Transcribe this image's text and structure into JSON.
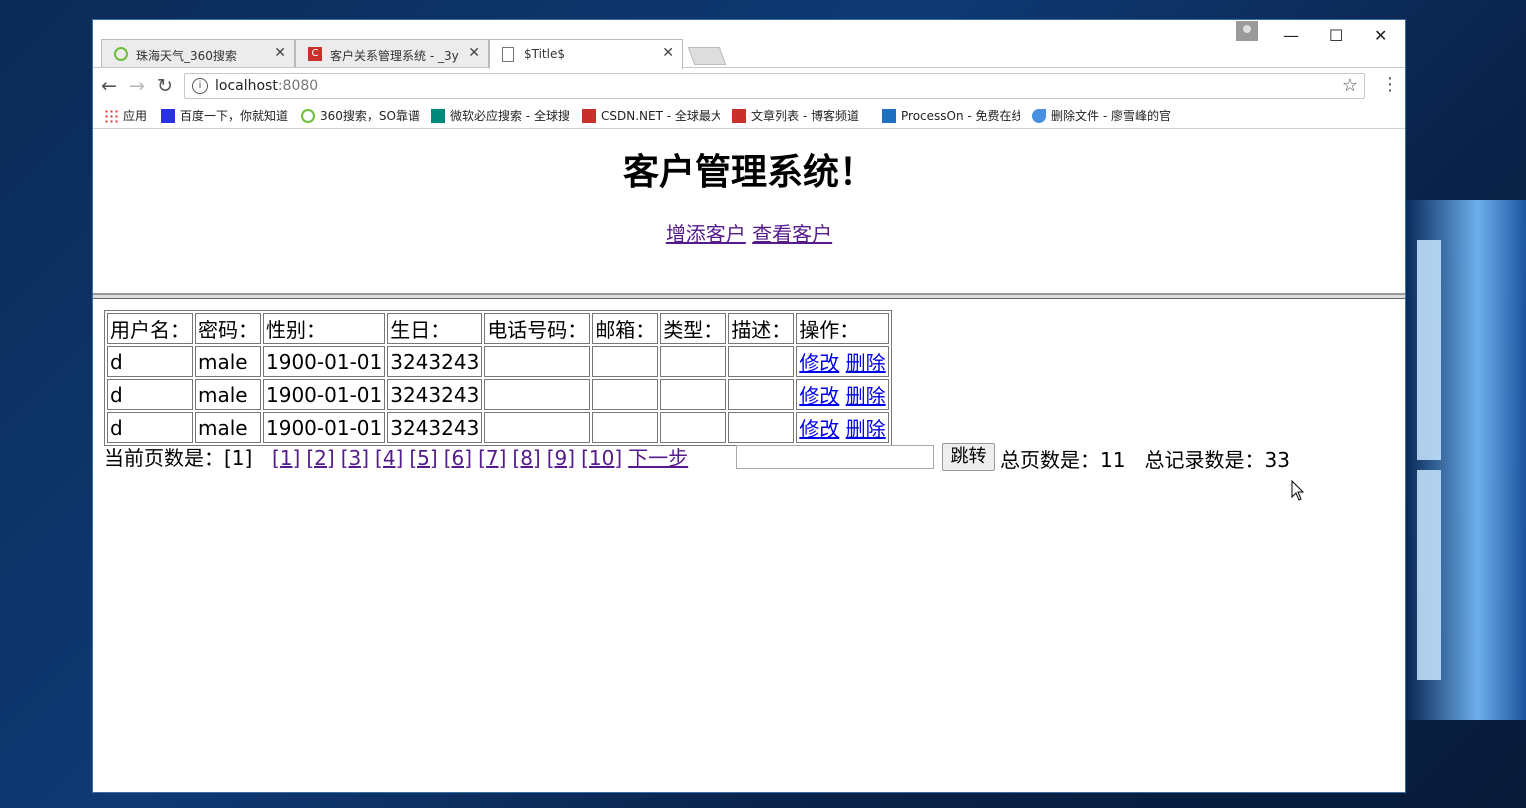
{
  "browser": {
    "tabs": [
      {
        "title": "珠海天气_360搜索",
        "icon": "360-search-icon",
        "color": "#6cbf3a"
      },
      {
        "title": "客户关系管理系统 - _3y",
        "icon": "csdn-icon",
        "color": "#c9302c"
      },
      {
        "title": "$Title$",
        "icon": "document-icon",
        "color": "#666666"
      }
    ],
    "url_host": "localhost",
    "url_port": ":8080",
    "bookmarks": [
      {
        "label": "应用",
        "icon": "apps-grid-icon"
      },
      {
        "label": "百度一下，你就知道",
        "icon": "baidu-paw-icon"
      },
      {
        "label": "360搜索，SO靠谱",
        "icon": "360-search-icon"
      },
      {
        "label": "微软必应搜索 - 全球搜",
        "icon": "bing-icon"
      },
      {
        "label": "CSDN.NET - 全球最大",
        "icon": "csdn-icon"
      },
      {
        "label": "文章列表 - 博客频道",
        "icon": "csdn-icon"
      },
      {
        "label": "ProcessOn - 免费在线",
        "icon": "processon-icon"
      },
      {
        "label": "删除文件 - 廖雪峰的官",
        "icon": "rocket-icon"
      }
    ]
  },
  "page": {
    "title": "客户管理系统！",
    "nav_links": [
      "增添客户",
      "查看客户"
    ],
    "table": {
      "headers": [
        "用户名：",
        "密码：",
        "性别：",
        "生日：",
        "电话号码：",
        "邮箱：",
        "类型：",
        "描述：",
        "操作："
      ],
      "rows": [
        [
          "d",
          "male",
          "1900-01-01",
          "3243243",
          "",
          "",
          "",
          ""
        ],
        [
          "d",
          "male",
          "1900-01-01",
          "3243243",
          "",
          "",
          "",
          ""
        ],
        [
          "d",
          "male",
          "1900-01-01",
          "3243243",
          "",
          "",
          "",
          ""
        ]
      ],
      "action_edit": "修改",
      "action_delete": "删除"
    },
    "pager": {
      "current_label": "当前页数是：[1]",
      "pages": [
        "[1]",
        "[2]",
        "[3]",
        "[4]",
        "[5]",
        "[6]",
        "[7]",
        "[8]",
        "[9]",
        "[10]",
        "下一步"
      ],
      "jump_button": "跳转",
      "total_pages_label": "总页数是：11",
      "total_records_label": "总记录数是：33"
    }
  }
}
